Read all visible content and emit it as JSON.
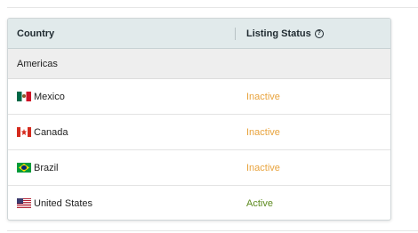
{
  "table": {
    "headers": {
      "country": "Country",
      "status": "Listing Status"
    },
    "group_label": "Americas",
    "rows": [
      {
        "flag": "mexico-flag-icon",
        "country": "Mexico",
        "status": "Inactive"
      },
      {
        "flag": "canada-flag-icon",
        "country": "Canada",
        "status": "Inactive"
      },
      {
        "flag": "brazil-flag-icon",
        "country": "Brazil",
        "status": "Inactive"
      },
      {
        "flag": "united-states-flag-icon",
        "country": "United States",
        "status": "Active"
      }
    ]
  },
  "colors": {
    "inactive": "#e8a33d",
    "active": "#5c8a1e",
    "header_bg": "#e1eaeb"
  }
}
